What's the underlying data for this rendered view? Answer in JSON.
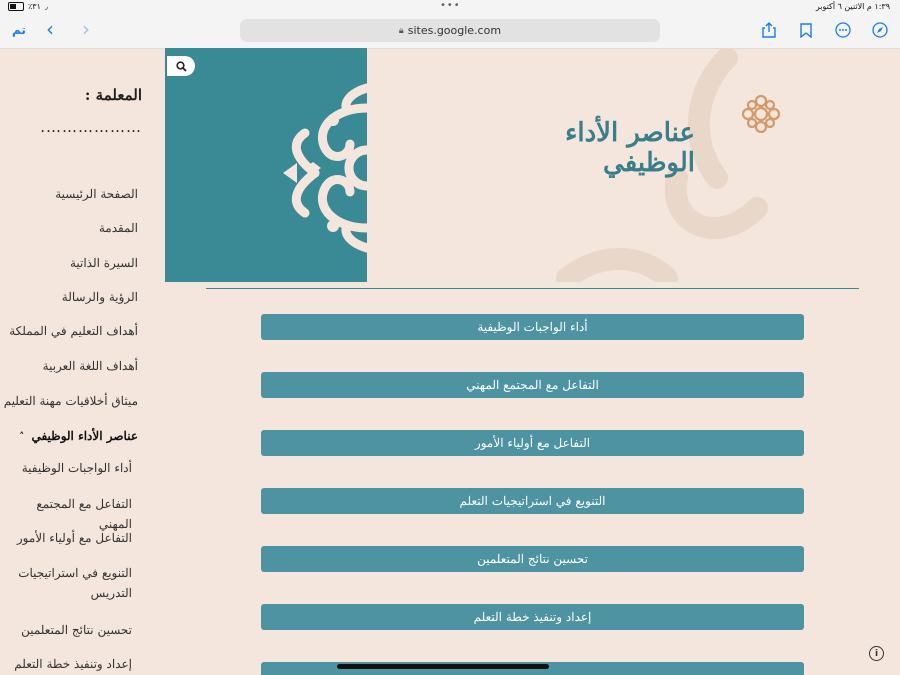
{
  "status_bar": {
    "battery": "٪٣١",
    "datetime": "١:٣٩ م  الاثنين ٦ أكتوبر"
  },
  "browser": {
    "done_label": "تم",
    "url": "sites.google.com",
    "accent_color": "#1b7cf2"
  },
  "sidebar": {
    "teacher_label": "المعلمة :",
    "teacher_name": "……………….",
    "items": [
      {
        "label": "الصفحة الرئيسية"
      },
      {
        "label": "المقدمة"
      },
      {
        "label": "السيرة الذاتية"
      },
      {
        "label": "الرؤية والرسالة"
      },
      {
        "label": "أهداف التعليم في المملكة"
      },
      {
        "label": "أهداف اللغة العربية"
      },
      {
        "label": "ميثاق أخلاقيات مهنة التعليم"
      },
      {
        "label": "عناصر الأداء الوظيفي"
      }
    ],
    "sub_items": [
      {
        "label": "أداء الواجبات الوظيفية"
      },
      {
        "label": "التفاعل مع المجتمع المهني"
      },
      {
        "label": "التفاعل مع أولياء الأمور"
      },
      {
        "label": "التنويع في استراتيجيات التدريس"
      },
      {
        "label": "تحسين نتائج المتعلمين"
      },
      {
        "label": "إعداد وتنفيذ خطة التعلم"
      }
    ]
  },
  "page": {
    "title": "عناصر الأداء الوظيفي",
    "theme_color": "#3a8a96"
  },
  "buttons": [
    {
      "label": "أداء الواجبات الوظيفية"
    },
    {
      "label": "التفاعل مع المجتمع المهني"
    },
    {
      "label": "التفاعل مع أولياء الأمور"
    },
    {
      "label": "التنويع في استراتيجيات التعلم"
    },
    {
      "label": "تحسين نتائج المتعلمين"
    },
    {
      "label": "إعداد وتنفيذ خطة التعلم"
    }
  ]
}
